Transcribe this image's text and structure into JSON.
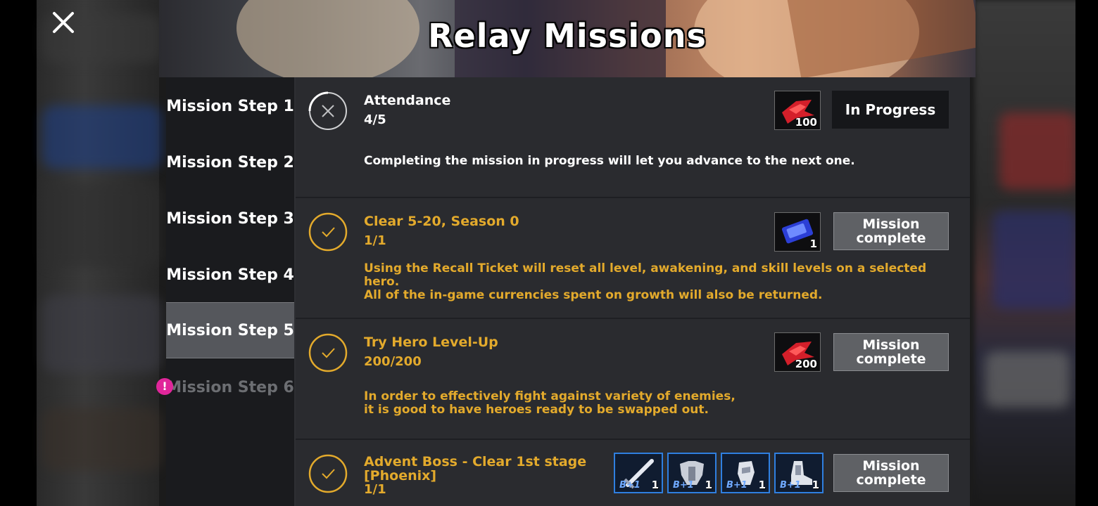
{
  "header": {
    "title": "Relay Missions",
    "close_icon": "close-icon"
  },
  "steps": [
    {
      "label": "Mission Step 1",
      "state": "normal"
    },
    {
      "label": "Mission Step 2",
      "state": "normal"
    },
    {
      "label": "Mission Step 3",
      "state": "normal"
    },
    {
      "label": "Mission Step 4",
      "state": "normal"
    },
    {
      "label": "Mission Step 5",
      "state": "selected"
    },
    {
      "label": "Mission Step 6",
      "state": "locked",
      "alert": "!"
    }
  ],
  "missions": [
    {
      "title": "Attendance",
      "progress": "4/5",
      "description": "Completing the mission in progress will let you advance to the next one.",
      "status": "in-progress",
      "button": "In Progress",
      "rewards": [
        {
          "icon": "red-gem-icon",
          "qty": "100"
        }
      ]
    },
    {
      "title": "Clear 5-20, Season 0",
      "progress": "1/1",
      "description": "Using the Recall Ticket will reset all level, awakening, and skill levels on a selected hero.\nAll of the in-game currencies spent on growth will also be returned.",
      "status": "complete",
      "button": "Mission complete",
      "rewards": [
        {
          "icon": "recall-ticket-icon",
          "qty": "1"
        }
      ]
    },
    {
      "title": "Try Hero Level-Up",
      "progress": "200/200",
      "description": "In order to effectively fight against variety of enemies,\nit is good to have heroes ready to be swapped out.",
      "status": "complete",
      "button": "Mission complete",
      "rewards": [
        {
          "icon": "red-gem-icon",
          "qty": "200"
        }
      ]
    },
    {
      "title": "Advent Boss - Clear 1st stage [Phoenix]",
      "progress": "1/1",
      "description": "",
      "status": "complete",
      "button": "Mission complete",
      "rewards": [
        {
          "icon": "sword-icon",
          "rank": "B+1",
          "qty": "1"
        },
        {
          "icon": "armor-icon",
          "rank": "B+1",
          "qty": "1"
        },
        {
          "icon": "gauntlet-icon",
          "rank": "B+1",
          "qty": "1"
        },
        {
          "icon": "boots-icon",
          "rank": "B+1",
          "qty": "1"
        }
      ]
    }
  ],
  "colors": {
    "accent_gold": "#e3aa2c",
    "alert_pink": "#e0269a",
    "equipment_border": "#2f7fe0"
  }
}
